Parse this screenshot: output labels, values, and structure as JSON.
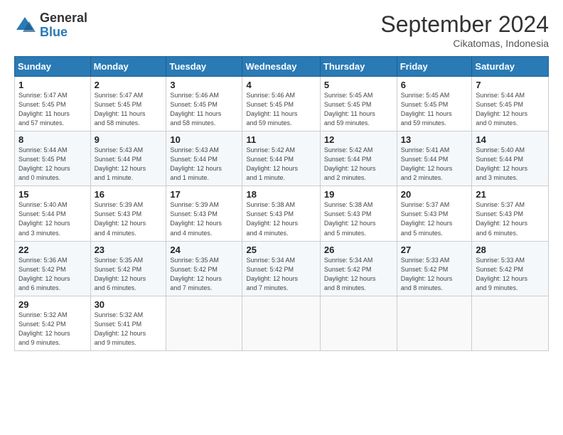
{
  "logo": {
    "general": "General",
    "blue": "Blue"
  },
  "header": {
    "title": "September 2024",
    "location": "Cikatomas, Indonesia"
  },
  "weekdays": [
    "Sunday",
    "Monday",
    "Tuesday",
    "Wednesday",
    "Thursday",
    "Friday",
    "Saturday"
  ],
  "weeks": [
    [
      {
        "day": "1",
        "info": "Sunrise: 5:47 AM\nSunset: 5:45 PM\nDaylight: 11 hours\nand 57 minutes."
      },
      {
        "day": "2",
        "info": "Sunrise: 5:47 AM\nSunset: 5:45 PM\nDaylight: 11 hours\nand 58 minutes."
      },
      {
        "day": "3",
        "info": "Sunrise: 5:46 AM\nSunset: 5:45 PM\nDaylight: 11 hours\nand 58 minutes."
      },
      {
        "day": "4",
        "info": "Sunrise: 5:46 AM\nSunset: 5:45 PM\nDaylight: 11 hours\nand 59 minutes."
      },
      {
        "day": "5",
        "info": "Sunrise: 5:45 AM\nSunset: 5:45 PM\nDaylight: 11 hours\nand 59 minutes."
      },
      {
        "day": "6",
        "info": "Sunrise: 5:45 AM\nSunset: 5:45 PM\nDaylight: 11 hours\nand 59 minutes."
      },
      {
        "day": "7",
        "info": "Sunrise: 5:44 AM\nSunset: 5:45 PM\nDaylight: 12 hours\nand 0 minutes."
      }
    ],
    [
      {
        "day": "8",
        "info": "Sunrise: 5:44 AM\nSunset: 5:45 PM\nDaylight: 12 hours\nand 0 minutes."
      },
      {
        "day": "9",
        "info": "Sunrise: 5:43 AM\nSunset: 5:44 PM\nDaylight: 12 hours\nand 1 minute."
      },
      {
        "day": "10",
        "info": "Sunrise: 5:43 AM\nSunset: 5:44 PM\nDaylight: 12 hours\nand 1 minute."
      },
      {
        "day": "11",
        "info": "Sunrise: 5:42 AM\nSunset: 5:44 PM\nDaylight: 12 hours\nand 1 minute."
      },
      {
        "day": "12",
        "info": "Sunrise: 5:42 AM\nSunset: 5:44 PM\nDaylight: 12 hours\nand 2 minutes."
      },
      {
        "day": "13",
        "info": "Sunrise: 5:41 AM\nSunset: 5:44 PM\nDaylight: 12 hours\nand 2 minutes."
      },
      {
        "day": "14",
        "info": "Sunrise: 5:40 AM\nSunset: 5:44 PM\nDaylight: 12 hours\nand 3 minutes."
      }
    ],
    [
      {
        "day": "15",
        "info": "Sunrise: 5:40 AM\nSunset: 5:44 PM\nDaylight: 12 hours\nand 3 minutes."
      },
      {
        "day": "16",
        "info": "Sunrise: 5:39 AM\nSunset: 5:43 PM\nDaylight: 12 hours\nand 4 minutes."
      },
      {
        "day": "17",
        "info": "Sunrise: 5:39 AM\nSunset: 5:43 PM\nDaylight: 12 hours\nand 4 minutes."
      },
      {
        "day": "18",
        "info": "Sunrise: 5:38 AM\nSunset: 5:43 PM\nDaylight: 12 hours\nand 4 minutes."
      },
      {
        "day": "19",
        "info": "Sunrise: 5:38 AM\nSunset: 5:43 PM\nDaylight: 12 hours\nand 5 minutes."
      },
      {
        "day": "20",
        "info": "Sunrise: 5:37 AM\nSunset: 5:43 PM\nDaylight: 12 hours\nand 5 minutes."
      },
      {
        "day": "21",
        "info": "Sunrise: 5:37 AM\nSunset: 5:43 PM\nDaylight: 12 hours\nand 6 minutes."
      }
    ],
    [
      {
        "day": "22",
        "info": "Sunrise: 5:36 AM\nSunset: 5:42 PM\nDaylight: 12 hours\nand 6 minutes."
      },
      {
        "day": "23",
        "info": "Sunrise: 5:35 AM\nSunset: 5:42 PM\nDaylight: 12 hours\nand 6 minutes."
      },
      {
        "day": "24",
        "info": "Sunrise: 5:35 AM\nSunset: 5:42 PM\nDaylight: 12 hours\nand 7 minutes."
      },
      {
        "day": "25",
        "info": "Sunrise: 5:34 AM\nSunset: 5:42 PM\nDaylight: 12 hours\nand 7 minutes."
      },
      {
        "day": "26",
        "info": "Sunrise: 5:34 AM\nSunset: 5:42 PM\nDaylight: 12 hours\nand 8 minutes."
      },
      {
        "day": "27",
        "info": "Sunrise: 5:33 AM\nSunset: 5:42 PM\nDaylight: 12 hours\nand 8 minutes."
      },
      {
        "day": "28",
        "info": "Sunrise: 5:33 AM\nSunset: 5:42 PM\nDaylight: 12 hours\nand 9 minutes."
      }
    ],
    [
      {
        "day": "29",
        "info": "Sunrise: 5:32 AM\nSunset: 5:42 PM\nDaylight: 12 hours\nand 9 minutes."
      },
      {
        "day": "30",
        "info": "Sunrise: 5:32 AM\nSunset: 5:41 PM\nDaylight: 12 hours\nand 9 minutes."
      },
      {
        "day": "",
        "info": ""
      },
      {
        "day": "",
        "info": ""
      },
      {
        "day": "",
        "info": ""
      },
      {
        "day": "",
        "info": ""
      },
      {
        "day": "",
        "info": ""
      }
    ]
  ]
}
